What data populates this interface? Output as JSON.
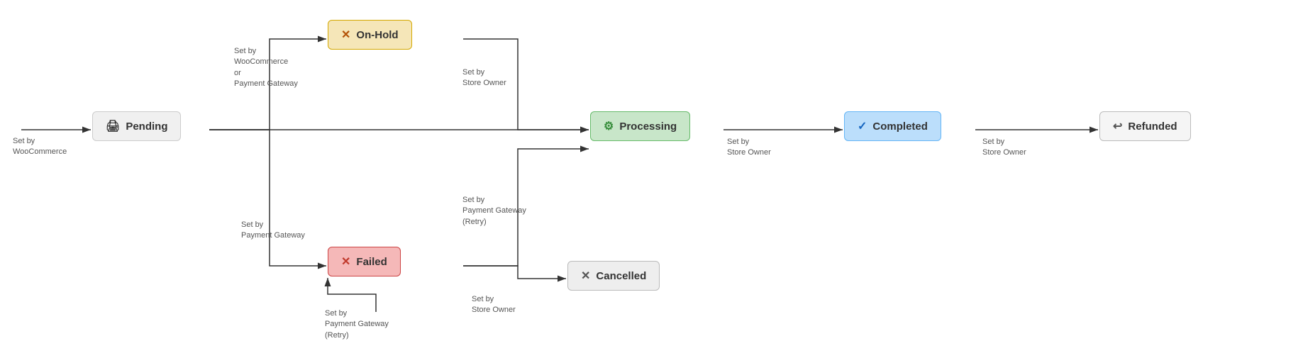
{
  "nodes": {
    "pending": {
      "label": "Pending",
      "icon": "🖨"
    },
    "onhold": {
      "label": "On-Hold",
      "icon": "✕"
    },
    "failed": {
      "label": "Failed",
      "icon": "✕"
    },
    "processing": {
      "label": "Processing",
      "icon": "⚙"
    },
    "completed": {
      "label": "Completed",
      "icon": "✓"
    },
    "refunded": {
      "label": "Refunded",
      "icon": "↩"
    },
    "cancelled": {
      "label": "Cancelled",
      "icon": "✕"
    }
  },
  "labels": {
    "set_by_woocommerce": "Set by\nWooCommerce",
    "set_by_woocommerce_or_gateway": "Set by\nWooCommerce\nor\nPayment Gateway",
    "set_by_store_owner_1": "Set by\nStore Owner",
    "set_by_payment_gateway": "Set by\nPayment Gateway",
    "set_by_store_owner_2": "Set by\nStore Owner",
    "set_by_store_owner_3": "Set by\nStore Owner",
    "set_by_payment_gateway_retry_1": "Set by\nPayment Gateway\n(Retry)",
    "set_by_payment_gateway_retry_2": "Set by\nPayment Gateway\n(Retry)",
    "set_by_store_owner_cancelled": "Set by\nStore Owner"
  }
}
